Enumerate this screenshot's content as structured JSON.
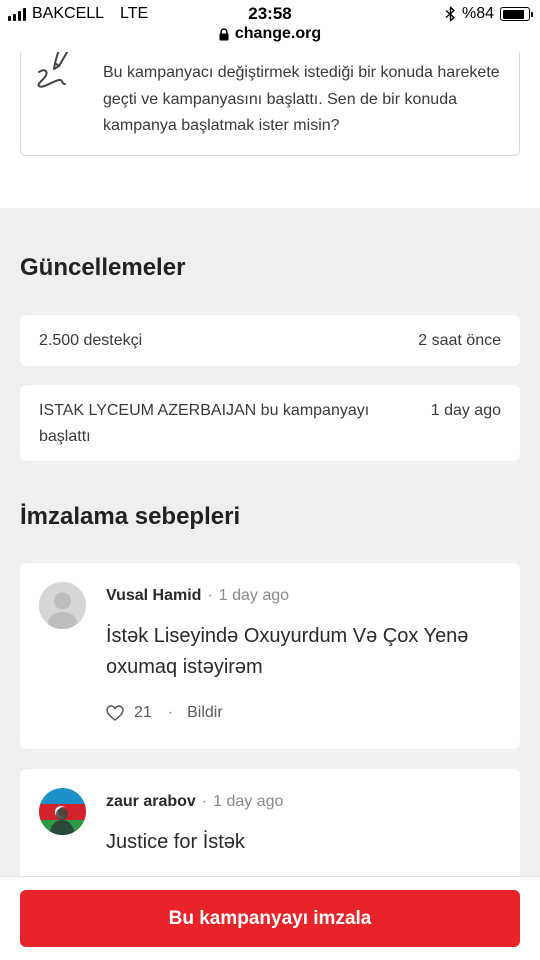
{
  "status_bar": {
    "carrier": "BAKCELL",
    "network": "LTE",
    "time": "23:58",
    "url": "change.org",
    "battery": "%84",
    "battery_level": 0.84
  },
  "starter_promo": {
    "text": "Bu kampanyacı değiştirmek istediği bir konuda harekete geçti ve kampanyasını başlattı. Sen de bir konuda kampanya başlatmak ister misin?"
  },
  "updates": {
    "title": "Güncellemeler",
    "items": [
      {
        "text": "2.500 destekçi",
        "time": "2 saat önce"
      },
      {
        "text_line1": "ISTAK LYCEUM AZERBAIJAN bu kampanyayı",
        "text_line2": "başlattı",
        "time": "1 day ago"
      }
    ]
  },
  "reasons": {
    "title": "İmzalama sebepleri",
    "items": [
      {
        "author": "Vusal Hamid",
        "separator": "·",
        "time": "1 day ago",
        "text": "İstək Liseyində Oxuyurdum Və Çox Yenə oxumaq istəyirəm",
        "likes": "21",
        "report_label": "Bildir",
        "avatar": "default-avatar-icon"
      },
      {
        "author": "zaur arabov",
        "separator": "·",
        "time": "1 day ago",
        "text": "Justice for İstək",
        "avatar": "azerbaijan-flag-photo"
      }
    ]
  },
  "sign_button": {
    "label": "Bu kampanyayı imzala"
  },
  "colors": {
    "accent_red": "#e8242a",
    "page_gray": "#efeff0",
    "card_white": "#ffffff",
    "muted_text": "#8a8a8a"
  }
}
